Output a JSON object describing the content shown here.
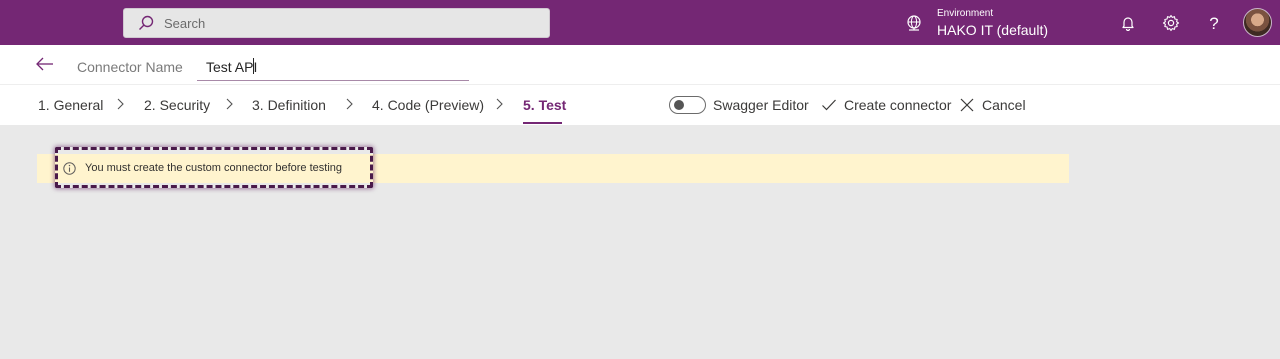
{
  "topbar": {
    "search_placeholder": "Search",
    "environment_label": "Environment",
    "environment_value": "HAKO IT (default)",
    "help_glyph": "?",
    "icons": [
      "search-icon",
      "environment-globe-icon",
      "bell-icon",
      "gear-icon",
      "help-icon",
      "avatar"
    ],
    "brand_color": "#742774"
  },
  "connector": {
    "name_label": "Connector Name",
    "name_value": "Test API"
  },
  "steps": [
    {
      "label": "1. General"
    },
    {
      "label": "2. Security"
    },
    {
      "label": "3. Definition"
    },
    {
      "label": "4. Code (Preview)"
    },
    {
      "label": "5. Test",
      "active": true
    }
  ],
  "actions": {
    "swagger_editor": "Swagger Editor",
    "swagger_editor_on": false,
    "create_connector": "Create connector",
    "cancel": "Cancel"
  },
  "warning": {
    "message": "You must create the custom connector before testing",
    "background": "#fff4ce"
  }
}
